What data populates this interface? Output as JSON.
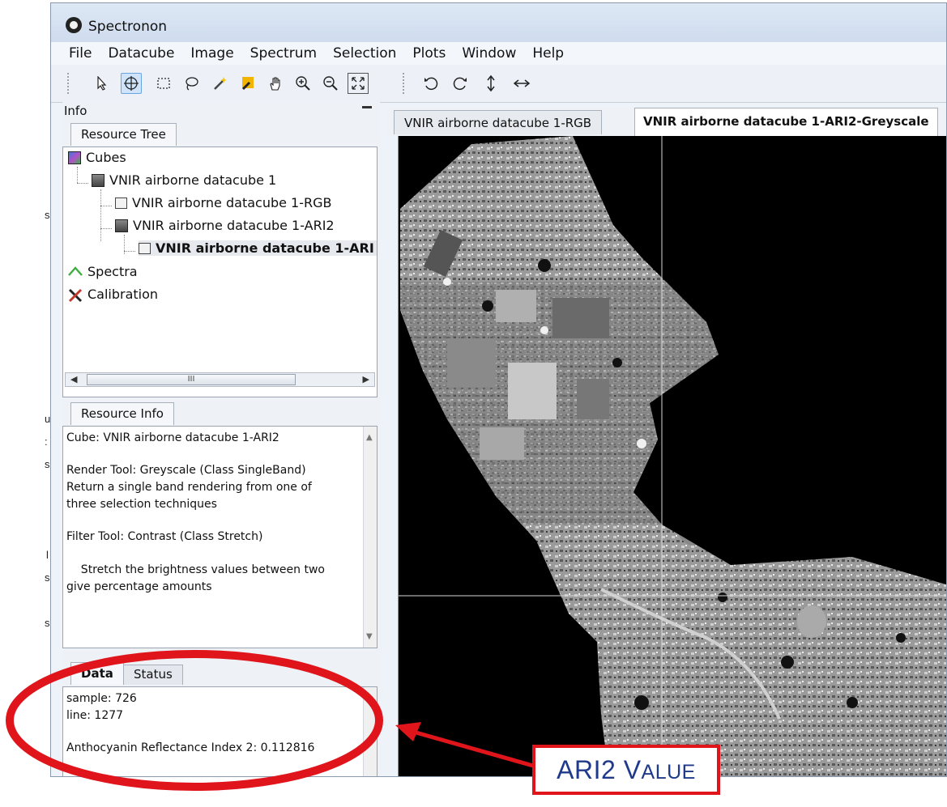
{
  "window": {
    "title": "Spectronon"
  },
  "menu": [
    "File",
    "Datacube",
    "Image",
    "Spectrum",
    "Selection",
    "Plots",
    "Window",
    "Help"
  ],
  "toolbar": {
    "tools": [
      "select-arrow-icon",
      "crosshair-icon",
      "rectangle-select-icon",
      "lasso-icon",
      "magic-wand-icon",
      "eyedropper-icon",
      "pan-hand-icon",
      "zoom-in-icon",
      "zoom-out-icon",
      "fit-to-window-icon"
    ],
    "transforms": [
      "rotate-left-icon",
      "rotate-right-icon",
      "flip-vertical-icon",
      "flip-horizontal-icon"
    ]
  },
  "left_panel": {
    "info_label": "Info",
    "resource_tree_tab": "Resource Tree",
    "tree": {
      "cubes": "Cubes",
      "cube1": "VNIR airborne datacube 1",
      "rgb": "VNIR airborne datacube 1-RGB",
      "ari2": "VNIR airborne datacube 1-ARI2",
      "ari2_child": "VNIR airborne datacube 1-ARI",
      "spectra": "Spectra",
      "calibration": "Calibration"
    },
    "scroll_thumb": "III",
    "resource_info_tab": "Resource Info",
    "resource_info": {
      "cube": "Cube: VNIR airborne datacube 1-ARI2",
      "render_tool": "Render Tool:  Greyscale (Class SingleBand)",
      "render_desc1": " Return a single band rendering from one of",
      "render_desc2": "three selection techniques",
      "filter_tool": "Filter Tool: Contrast (Class Stretch)",
      "filter_desc1": "    Stretch the brightness values between two",
      "filter_desc2": "give percentage amounts"
    },
    "data_tab": "Data",
    "status_tab": "Status",
    "data": {
      "sample": "sample: 726",
      "line": "line: 1277",
      "ari": "Anthocyanin Reflectance Index 2: 0.112816"
    }
  },
  "image_tabs": {
    "tab1": "VNIR airborne datacube 1-RGB",
    "tab2": "VNIR airborne datacube 1-ARI2-Greyscale"
  },
  "annotation": {
    "callout_A": "ARI2 V",
    "callout_B": "ALUE",
    "color": "#e0141b",
    "text_color": "#1f3a8a"
  },
  "edge_letters": [
    "s",
    "u",
    ":",
    "s",
    "l",
    "s",
    "s"
  ]
}
